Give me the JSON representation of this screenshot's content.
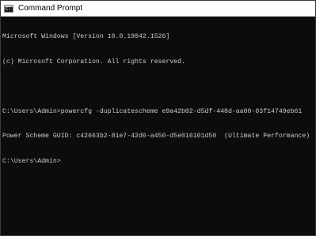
{
  "window": {
    "title": "Command Prompt",
    "icon": "command-prompt-icon"
  },
  "console": {
    "lines": [
      "Microsoft Windows [Version 10.0.19042.1526]",
      "(c) Microsoft Corporation. All rights reserved.",
      "",
      "C:\\Users\\Admin>powercfg -duplicatescheme e9a42b02-d5df-448d-aa00-03f14749eb61",
      "Power Scheme GUID: c42663b2-81e7-42d6-a450-d5e016101d50  (Ultimate Performance)",
      "C:\\Users\\Admin>"
    ]
  },
  "colors": {
    "console_background": "#0c0c0c",
    "console_text": "#cccccc",
    "titlebar_background": "#ffffff"
  }
}
